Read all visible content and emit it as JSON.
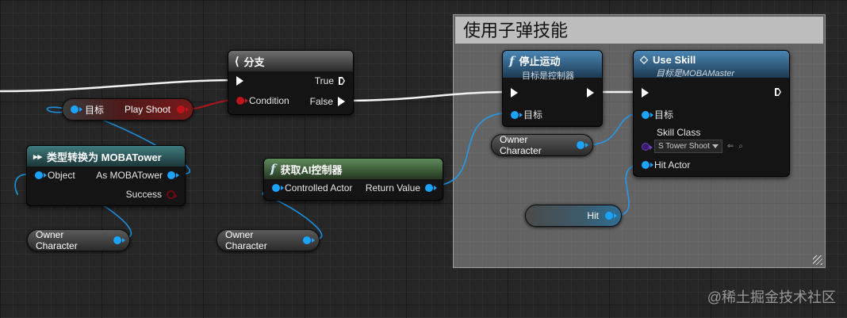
{
  "comment": {
    "title": "使用子弹技能"
  },
  "branch": {
    "title": "分支",
    "icon": "branch-icon",
    "condition": "Condition",
    "true_label": "True",
    "false_label": "False"
  },
  "play_shoot_pill": {
    "target": "目标",
    "label": "Play Shoot"
  },
  "cast": {
    "title": "类型转换为 MOBATower",
    "icon": "cast-icon",
    "object": "Object",
    "as_out": "As MOBATower",
    "success": "Success"
  },
  "get_ai": {
    "title": "获取AI控制器",
    "icon": "function-icon",
    "controlled_actor": "Controlled Actor",
    "return_value": "Return Value"
  },
  "stop_move": {
    "title": "停止运动",
    "subtitle": "目标是控制器",
    "icon": "function-icon",
    "target": "目标"
  },
  "use_skill": {
    "title": "Use Skill",
    "subtitle": "目标是MOBAMaster",
    "icon": "event-diamond-icon",
    "target": "目标",
    "skill_class": "Skill Class",
    "skill_class_value": "S Tower Shoot",
    "hit_actor": "Hit Actor"
  },
  "owner_pills": [
    "Owner Character",
    "Owner Character",
    "Owner Character"
  ],
  "hit_pill": {
    "label": "Hit"
  },
  "watermark": "@稀土掘金技术社区",
  "colors": {
    "exec": "#ffffff",
    "object_pin": "#1aa3ff",
    "bool_pin": "#c0141d",
    "class_pin": "#6c3fbf",
    "comment_bg": "#bdbdbd"
  }
}
